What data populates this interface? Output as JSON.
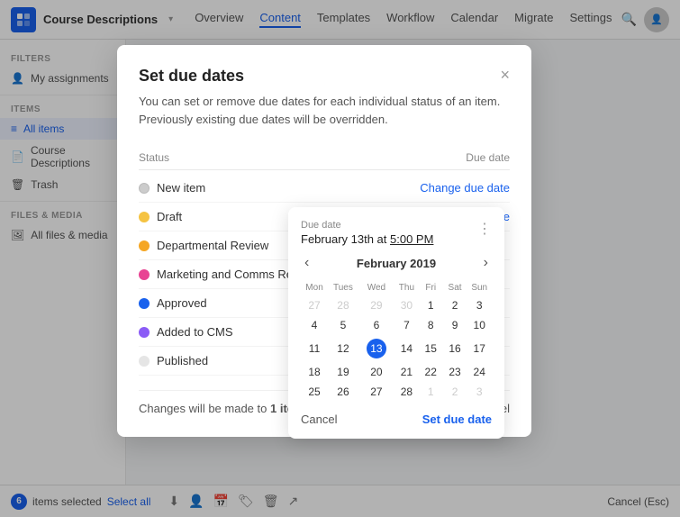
{
  "nav": {
    "app_name": "Course Descriptions",
    "links": [
      "Overview",
      "Content",
      "Templates",
      "Workflow",
      "Calendar",
      "Migrate",
      "Settings"
    ],
    "active_link": "Content"
  },
  "sidebar": {
    "filters_label": "FILTERS",
    "items_label": "ITEMS",
    "files_label": "FILES & MEDIA",
    "items": [
      {
        "label": "My assignments",
        "icon": "👤",
        "active": false
      },
      {
        "label": "All items",
        "icon": "≡",
        "active": true
      },
      {
        "label": "Course Descriptions",
        "icon": "📄",
        "active": false
      },
      {
        "label": "Trash",
        "icon": "🗑",
        "active": false
      },
      {
        "label": "All files & media",
        "icon": "🖼",
        "active": false
      }
    ]
  },
  "modal": {
    "title": "Set due dates",
    "description": "You can set or remove due dates for each individual status of an item. Previously existing due dates will be overridden.",
    "close_label": "×",
    "table": {
      "header_status": "Status",
      "header_due_date": "Due date",
      "rows": [
        {
          "name": "New item",
          "dot_class": "gray",
          "action": "Change due date"
        },
        {
          "name": "Draft",
          "dot_class": "yellow",
          "action": "Change due date"
        },
        {
          "name": "Departmental Review",
          "dot_class": "orange",
          "action": ""
        },
        {
          "name": "Marketing and Comms Review",
          "dot_class": "pink",
          "action": ""
        },
        {
          "name": "Approved",
          "dot_class": "blue",
          "action": ""
        },
        {
          "name": "Added to CMS",
          "dot_class": "purple",
          "action": ""
        },
        {
          "name": "Published",
          "dot_class": "light-gray",
          "action": ""
        }
      ]
    },
    "footer_text": "Changes will be made to",
    "footer_bold": "1 item",
    "cancel_label": "Cancel"
  },
  "date_picker": {
    "label": "Due date",
    "value_date": "February 13th at",
    "value_time": "5:00 PM",
    "month_year": "February 2019",
    "days_of_week": [
      "Mon",
      "Tues",
      "Wed",
      "Thu",
      "Fri",
      "Sat",
      "Sun"
    ],
    "weeks": [
      [
        "27",
        "28",
        "29",
        "30",
        "1",
        "2",
        "3"
      ],
      [
        "4",
        "5",
        "6",
        "7",
        "8",
        "9",
        "10"
      ],
      [
        "11",
        "12",
        "13",
        "14",
        "15",
        "16",
        "17"
      ],
      [
        "18",
        "19",
        "20",
        "21",
        "22",
        "23",
        "24"
      ],
      [
        "25",
        "26",
        "27",
        "28",
        "1",
        "2",
        "3"
      ]
    ],
    "other_month_week1": [
      true,
      true,
      true,
      true,
      false,
      false,
      false
    ],
    "other_month_week5": [
      false,
      false,
      false,
      false,
      true,
      true,
      true
    ],
    "today_row": 2,
    "today_col": 2,
    "cancel_label": "Cancel",
    "set_label": "Set due date"
  },
  "bottom_bar": {
    "selected_count": "6",
    "selected_text": "items selected",
    "select_all": "Select all",
    "cancel_label": "Cancel (Esc)"
  }
}
